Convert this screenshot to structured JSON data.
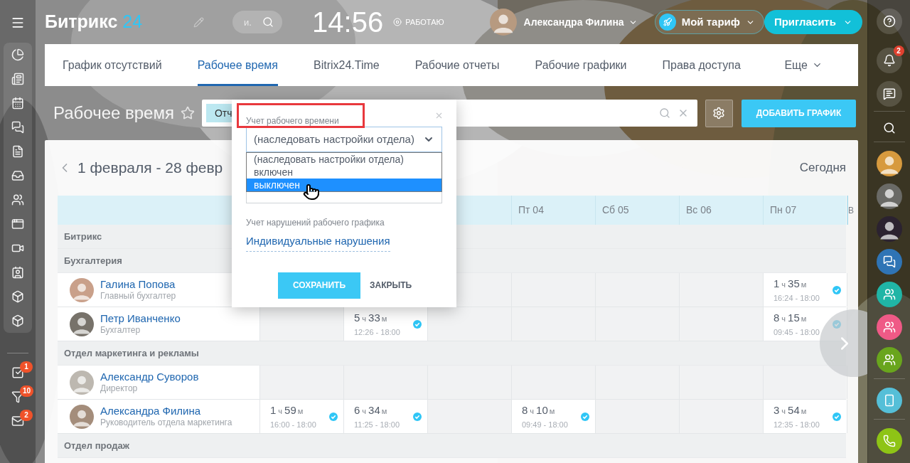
{
  "header": {
    "logo_name": "Битрикс",
    "logo_number": "24",
    "search": {
      "placeholder": "и."
    },
    "clock": "14:56",
    "status": "РАБОТАЮ",
    "user": "Александра Филина",
    "plan_button": "Мой тариф",
    "invite_button": "Пригласить"
  },
  "left_sidebar": {
    "bottom_items": [
      {
        "kind": "tasks",
        "badge": "1"
      },
      {
        "kind": "filter",
        "badge": "10"
      },
      {
        "kind": "mail",
        "badge": "2"
      }
    ]
  },
  "right_sidebar": {
    "notifications_badge": "2"
  },
  "tabs": [
    {
      "label": "График отсутствий",
      "selected": false
    },
    {
      "label": "Рабочее время",
      "selected": true
    },
    {
      "label": "Bitrix24.Time",
      "selected": false
    },
    {
      "label": "Рабочие отчеты",
      "selected": false
    },
    {
      "label": "Рабочие графики",
      "selected": false
    },
    {
      "label": "Права доступа",
      "selected": false
    },
    {
      "label": "Еще",
      "selected": false
    }
  ],
  "toolbar": {
    "title": "Рабочее время",
    "filter_chip": "Отч",
    "add_button": "ДОБАВИТЬ ГРАФИК"
  },
  "calendar": {
    "period": "1 февраля - 28 февр",
    "today": "Сегодня",
    "days": [
      "Пт 04",
      "Сб 05",
      "Вс 06",
      "Пн 07",
      "В"
    ],
    "rows": [
      {
        "kind": "group",
        "label": "Битрикс"
      },
      {
        "kind": "group",
        "label": "Бухгалтерия"
      },
      {
        "kind": "person",
        "name": "Галина Попова",
        "position": "Главный бухгалтер",
        "cells": [
          null,
          null,
          null,
          null,
          null,
          null,
          {
            "hours": "1",
            "h_unit": "ч",
            "minutes": "35",
            "m_unit": "м",
            "range": "16:24 - 18:00",
            "confirmed": true
          },
          null
        ]
      },
      {
        "kind": "person",
        "name": "Петр Иванченко",
        "position": "Бухгалтер",
        "cells": [
          null,
          {
            "hours": "5",
            "h_unit": "ч",
            "minutes": "33",
            "m_unit": "м",
            "range": "12:26 - 18:00",
            "confirmed": true
          },
          null,
          null,
          null,
          null,
          {
            "hours": "8",
            "h_unit": "ч",
            "minutes": "15",
            "m_unit": "м",
            "range": "09:45 - 18:00",
            "confirmed": true
          },
          null
        ]
      },
      {
        "kind": "group",
        "label": "Отдел маркетинга и рекламы"
      },
      {
        "kind": "person",
        "name": "Александр Суворов",
        "position": "Директор",
        "cells": [
          null,
          null,
          null,
          null,
          null,
          null,
          null,
          null
        ]
      },
      {
        "kind": "person",
        "name": "Александра Филина",
        "position": "Руководитель отдела маркетинга",
        "cells": [
          {
            "hours": "1",
            "h_unit": "ч",
            "minutes": "59",
            "m_unit": "м",
            "range": "16:00 - 18:00",
            "confirmed": true
          },
          {
            "hours": "6",
            "h_unit": "ч",
            "minutes": "34",
            "m_unit": "м",
            "range": "11:25 - 18:00",
            "confirmed": true
          },
          null,
          {
            "hours": "8",
            "h_unit": "ч",
            "minutes": "10",
            "m_unit": "м",
            "range": "09:49 - 18:00",
            "confirmed": true
          },
          null,
          null,
          {
            "hours": "3",
            "h_unit": "ч",
            "minutes": "54",
            "m_unit": "м",
            "range": "12:35 - 18:00",
            "confirmed": true
          },
          null
        ]
      },
      {
        "kind": "group",
        "label": "Отдел продаж"
      }
    ]
  },
  "popup": {
    "label": "Учет рабочего времени",
    "highlighted": true,
    "select_value": "(наследовать настройки отдела)",
    "options": [
      {
        "label": "(наследовать настройки отдела)",
        "selected": false
      },
      {
        "label": "включен",
        "selected": false
      },
      {
        "label": "выключен",
        "selected": true
      }
    ],
    "violations_label": "Учет нарушений рабочего графика",
    "violations_link": "Индивидуальные нарушения",
    "save_button": "СОХРАНИТЬ",
    "close_button": "ЗАКРЫТЬ"
  }
}
